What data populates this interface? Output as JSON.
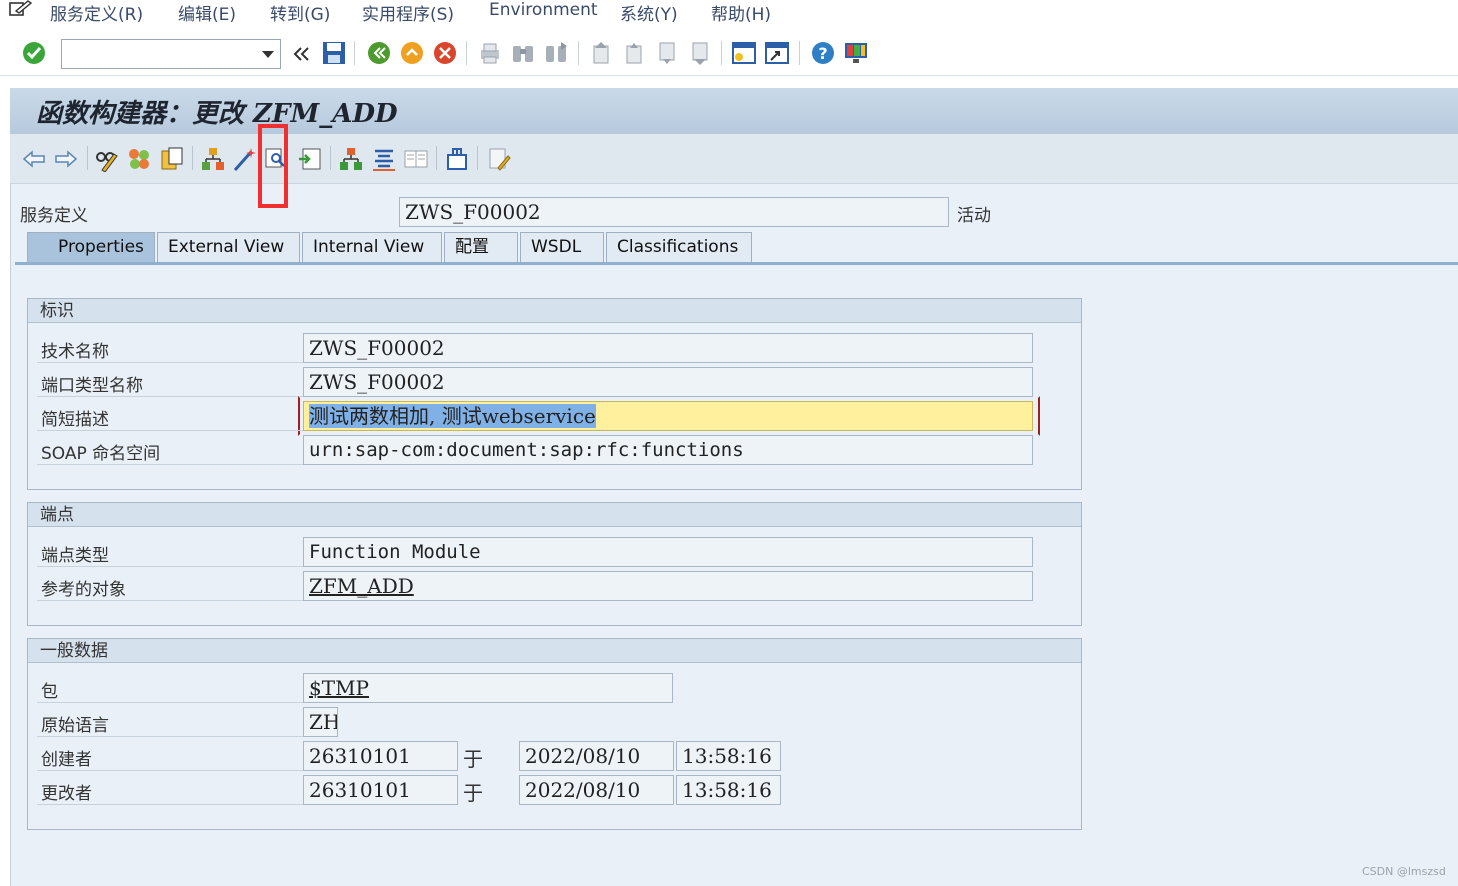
{
  "menu": {
    "items": [
      "服务定义(R)",
      "编辑(E)",
      "转到(G)",
      "实用程序(S)",
      "Environment",
      "系统(Y)",
      "帮助(H)"
    ]
  },
  "system_toolbar": {
    "command_field_value": "",
    "icons": [
      "enter-check-icon",
      "double-arrow-icon",
      "save-icon",
      "back-icon",
      "exit-icon",
      "cancel-icon",
      "print-icon",
      "find-icon",
      "find-next-icon",
      "first-page-icon",
      "previous-page-icon",
      "next-page-icon",
      "last-page-icon",
      "new-session-icon",
      "shortcut-icon",
      "help-icon",
      "customize-layout-icon"
    ]
  },
  "title": "函数构建器：更改 ZFM_ADD",
  "app_toolbar": {
    "icons": [
      "back-arrow-icon",
      "forward-arrow-icon",
      "display-change-icon",
      "other-object-icon",
      "copy-icon",
      "hierarchy-icon",
      "wizard-icon",
      "where-used-icon",
      "import-icon",
      "object-list-icon",
      "navigation-icon",
      "display-list-icon",
      "transport-icon",
      "documentation-icon"
    ]
  },
  "header": {
    "label": "服务定义",
    "value": "ZWS_F00002",
    "status": "活动"
  },
  "tabs": [
    {
      "label": "Properties",
      "active": true
    },
    {
      "label": "External View",
      "active": false
    },
    {
      "label": "Internal View",
      "active": false
    },
    {
      "label": "配置",
      "active": false
    },
    {
      "label": "WSDL",
      "active": false
    },
    {
      "label": "Classifications",
      "active": false
    }
  ],
  "identification": {
    "title": "标识",
    "tech_name_label": "技术名称",
    "tech_name_value": "ZWS_F00002",
    "port_type_label": "端口类型名称",
    "port_type_value": "ZWS_F00002",
    "short_desc_label": "简短描述",
    "short_desc_value": "测试两数相加, 测试webservice",
    "soap_ns_label": "SOAP 命名空间",
    "soap_ns_value": "urn:sap-com:document:sap:rfc:functions"
  },
  "endpoint": {
    "title": "端点",
    "type_label": "端点类型",
    "type_value": "Function Module",
    "ref_label": "参考的对象",
    "ref_value": "ZFM_ADD"
  },
  "general": {
    "title": "一般数据",
    "package_label": "包",
    "package_value": "$TMP",
    "lang_label": "原始语言",
    "lang_value": "ZH",
    "creator_label": "创建者",
    "creator_value": "26310101",
    "creator_at": "于",
    "creator_date": "2022/08/10",
    "creator_time": "13:58:16",
    "changer_label": "更改者",
    "changer_value": "26310101",
    "changer_at": "于",
    "changer_date": "2022/08/10",
    "changer_time": "13:58:16"
  },
  "colors": {
    "highlight_frame": "#f03030",
    "focused_field": "#fff09e",
    "selection": "#7fb0e6"
  },
  "watermark": "CSDN @lmszsd"
}
